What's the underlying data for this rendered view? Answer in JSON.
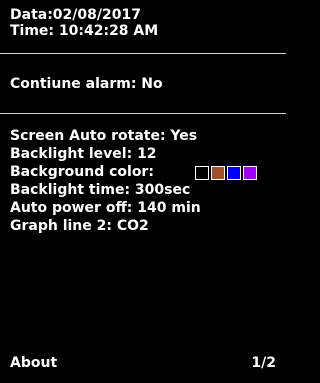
{
  "header": {
    "date_line": "Data:02/08/2017",
    "time_line": "Time: 10:42:28 AM"
  },
  "alarm": {
    "line": "Contiune alarm: No"
  },
  "settings": {
    "screen_auto_rotate": "Screen Auto rotate: Yes",
    "backlight_level": "Backlight level: 12",
    "background_color_label": "Background color:",
    "background_color_options": [
      "#000000",
      "#a0522d",
      "#0000ff",
      "#9b00ff"
    ],
    "backlight_time": "Backlight time: 300sec",
    "auto_power_off": "Auto power off: 140 min",
    "graph_line_2": "Graph line 2: CO2"
  },
  "footer": {
    "about_label": "About",
    "page_indicator": "1/2"
  },
  "colors": {
    "background": "#000000",
    "text": "#ffffff",
    "divider": "#cfcfcf"
  }
}
